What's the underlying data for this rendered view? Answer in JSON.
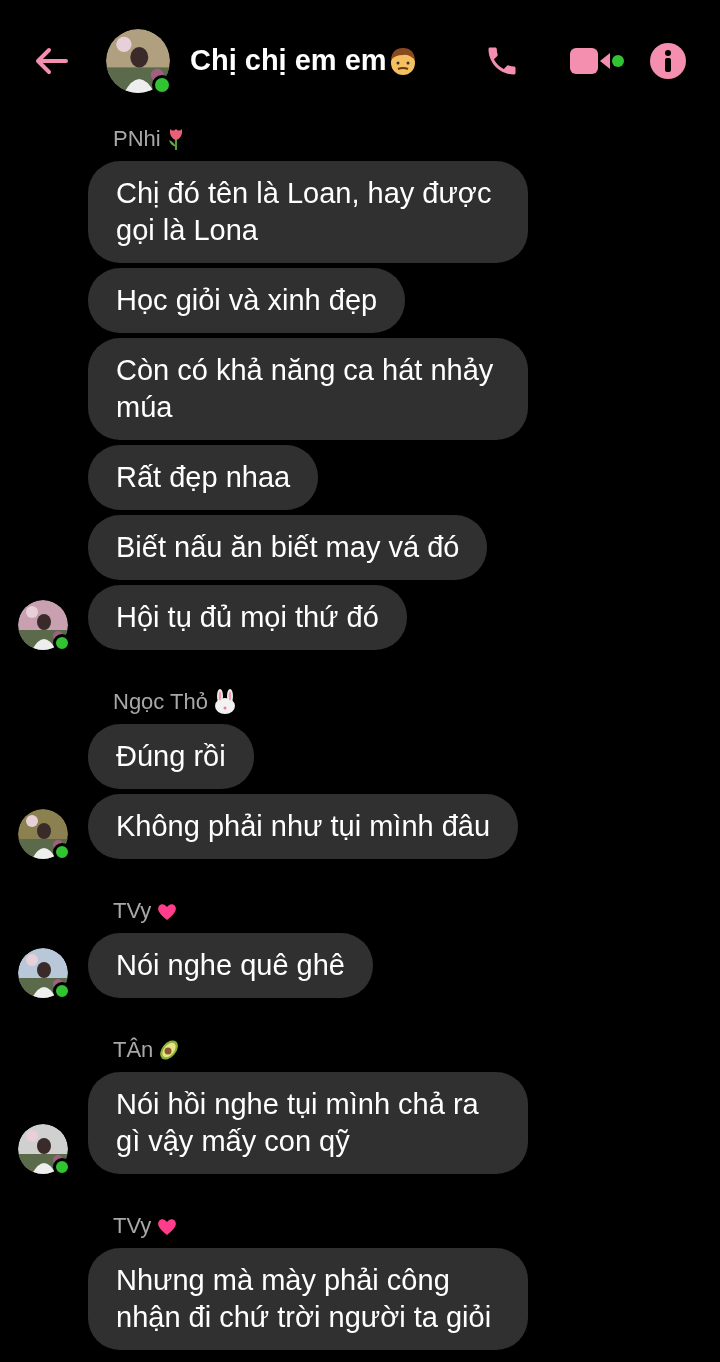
{
  "header": {
    "title": "Chị chị em em",
    "online": true
  },
  "groups": [
    {
      "sender": "PNhi",
      "online": true,
      "messages": [
        "Chị đó tên là Loan, hay được gọi là Lona",
        "Học giỏi và xinh đẹp",
        "Còn có khả năng ca hát nhảy múa",
        "Rất đẹp nhaa",
        "Biết nấu ăn biết may vá đó",
        "Hội tụ đủ mọi thứ đó"
      ]
    },
    {
      "sender": "Ngọc Thỏ",
      "online": true,
      "messages": [
        "Đúng rồi",
        "Không phải như tụi mình đâu"
      ]
    },
    {
      "sender": "TVy",
      "online": true,
      "messages": [
        "Nói nghe quê ghê"
      ]
    },
    {
      "sender": "TÂn",
      "online": true,
      "messages": [
        "Nói hồi nghe tụi mình chả ra gì vậy mấy con qỹ"
      ]
    },
    {
      "sender": "TVy",
      "messages": [
        "Nhưng mà mày phải công nhận đi chứ trời người ta giỏi"
      ]
    }
  ]
}
